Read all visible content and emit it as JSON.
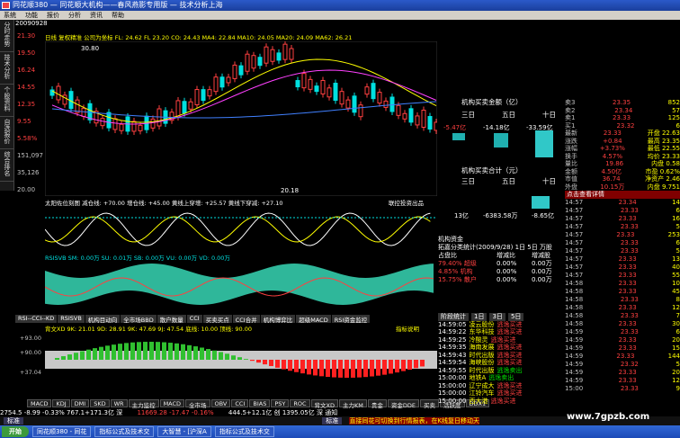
{
  "window": {
    "title": "同花顺380 — 同花顺大机构——春风燕影专用版 — 技术分析上海"
  },
  "menu": [
    "系统",
    "功能",
    "报价",
    "分析",
    "资讯",
    "帮助"
  ],
  "toolbar": [
    "同花顺",
    "趋势先锋",
    "自选股",
    "资金动向",
    "LEVEL-2",
    "大机构客服",
    "技术分析",
    "分析",
    "板块指数",
    "港汇",
    "发现"
  ],
  "sidetabs": [
    "分时走势",
    "技术分析",
    "个股资料",
    "自选报价",
    "综合排名"
  ],
  "chart": {
    "date": "20090928",
    "info": "日线 复权精准 公司为坐标 FL: 24.62 FL 23.20 CO: 24.43 MA4: 22.84 MA10: 24.05 MA20: 24.09 MA62: 26.21",
    "yticks": [
      "21.30",
      "19.50",
      "16.24",
      "14.55",
      "12.35",
      "9.55",
      "5.58%",
      "151,097",
      "35,126",
      "20.00"
    ],
    "hi_label": "30.80",
    "lo_label": "20.18"
  },
  "panels": {
    "sun": "太阳佐位刻图 减仓线: +70.00 增仓线: +45.00 黄线上穿增: +25.57 黄线下穿减: +27.10",
    "sun_right": "联控投资出品",
    "rsi": "RSISVB SM: 0.00万 SU: 0.01万 SB: 0.00万 VU: 0.00万 VD: 0.00万",
    "kdj": "背文XD 9K: 21.01 9D: 28.91 9K: 47.69 9J: 47.54 底线: 10.00 顶线: 90.00",
    "kdj_right": "指标说明",
    "kdj_ticks": [
      "+93.00",
      "+90.00",
      "+37.04"
    ],
    "tabs": [
      "RSI--CCI--KD",
      "RSISVB",
      "机构目动向",
      "全市场BBD",
      "散户数量",
      "CCI",
      "买卖买点",
      "CCI合并",
      "机构博弈比",
      "超级MACD",
      "RSI资金监控"
    ]
  },
  "bottomtabs": [
    "MACD",
    "KDJ",
    "DMI",
    "SKD",
    "WR",
    "主力监控",
    "MACD",
    "全市场",
    "OBV",
    "CCI",
    "BIAS",
    "PSY",
    "ROC",
    "背文XD",
    "主力KM",
    "贵金",
    "资金DDE",
    "买卖",
    "活跃度",
    "DDX1"
  ],
  "status": {
    "left": "2754.5 -8.99 -0.33% 767.1+171.3亿 深",
    "mid": "11669.28 -17.47 -0.16%",
    "right": "444.5+12.1亿 创 1395.05亿 深 通知",
    "ticker": "直接同花可切换到行情报表，在K线复日移动天"
  },
  "statusbar2": {
    "a": "标准",
    "b": "标准"
  },
  "right": {
    "t1": "机构买卖金额（亿）",
    "cols": [
      "三日",
      "五日",
      "十日"
    ],
    "vals1": [
      "-5.47亿",
      "-14.18亿",
      "-33.59亿"
    ],
    "t2": "机构买卖合计（元）",
    "v2a": "-6383.58万",
    "v2b": "-8.65亿",
    "v2c": "13亿"
  },
  "funds": {
    "title": "机构资金",
    "sub": "拓嘉分类统计(2009/9/28) 1日 5日 万股",
    "rows": [
      [
        "占盘比",
        "增减比",
        "增减股"
      ],
      [
        "79.40% 超级",
        "0.00%",
        "0.00万"
      ],
      [
        "4.85% 机构",
        "0.00%",
        "0.00万"
      ],
      [
        "15.75% 散户",
        "0.00%",
        "0.00万"
      ]
    ]
  },
  "sectors": {
    "header": [
      "阶段统计",
      "1日",
      "3日",
      "5日"
    ],
    "rows": [
      [
        "14:59:05",
        "凌云股份",
        "逃逸买进"
      ],
      [
        "14:59:22",
        "东华科技",
        "逃逸买进"
      ],
      [
        "14:59:25",
        "冷酸灵",
        "逃逸买进"
      ],
      [
        "14:59:35",
        "海南发展",
        "逃逸买进"
      ],
      [
        "14:59:43",
        "时代出版",
        "逃逸买进"
      ],
      [
        "14:59:54",
        "海峡股份",
        "逃逸买进"
      ],
      [
        "14:59:55",
        "时代出版",
        "逃逸卖出"
      ],
      [
        "15:00:00",
        "地铁A",
        "逃逸卖出"
      ],
      [
        "15:00:00",
        "辽宁成大",
        "逃逸买进"
      ],
      [
        "15:00:00",
        "江铃汽车",
        "逃逸买进"
      ],
      [
        "15:00:00",
        "西大港",
        "逃逸买进"
      ]
    ]
  },
  "quote": {
    "rows": [
      [
        "卖3",
        "23.35",
        "852"
      ],
      [
        "卖2",
        "23.34",
        "57"
      ],
      [
        "卖1",
        "23.33",
        "125"
      ],
      [
        "买1",
        "23.32",
        "6"
      ],
      [
        "最新",
        "23.33",
        "开盘 22.63"
      ],
      [
        "涨跌",
        "+0.84",
        "最高 23.35"
      ],
      [
        "涨幅",
        "+3.73%",
        "最低 22.55"
      ],
      [
        "换手",
        "4.57%",
        "均价 23.33"
      ],
      [
        "量比",
        "19.86",
        "内盘 0.58"
      ],
      [
        "金额",
        "4.50亿",
        "市盈 0.62%"
      ],
      [
        "市值",
        "36.74",
        "净资产 2.46"
      ],
      [
        "外盘",
        "10.15万",
        "内盘 9.751"
      ]
    ]
  },
  "ticks": {
    "title": "点击查看详情",
    "rows": [
      [
        "14:57",
        "23.34",
        "14"
      ],
      [
        "14:57",
        "23.33",
        "6"
      ],
      [
        "14:57",
        "23.33",
        "16"
      ],
      [
        "14:57",
        "23.33",
        "5"
      ],
      [
        "14:57",
        "23.33",
        "253"
      ],
      [
        "14:57",
        "23.33",
        "6"
      ],
      [
        "14:57",
        "23.33",
        "5"
      ],
      [
        "14:57",
        "23.33",
        "13"
      ],
      [
        "14:57",
        "23.33",
        "40"
      ],
      [
        "14:57",
        "23.33",
        "55"
      ],
      [
        "14:58",
        "23.33",
        "10"
      ],
      [
        "14:58",
        "23.33",
        "45"
      ],
      [
        "14:58",
        "23.33",
        "8"
      ],
      [
        "14:58",
        "23.33",
        "12"
      ],
      [
        "14:58",
        "23.33",
        "7"
      ],
      [
        "14:58",
        "23.33",
        "30"
      ],
      [
        "14:59",
        "23.33",
        "6"
      ],
      [
        "14:59",
        "23.33",
        "20"
      ],
      [
        "14:59",
        "23.33",
        "15"
      ],
      [
        "14:59",
        "23.33",
        "144"
      ],
      [
        "14:59",
        "23.32",
        "5"
      ],
      [
        "14:59",
        "23.33",
        "20"
      ],
      [
        "14:59",
        "23.33",
        "12"
      ],
      [
        "15:00",
        "23.33",
        "9"
      ]
    ]
  },
  "taskbar": {
    "start": "开始",
    "tasks": [
      "同花顺380 - 同花",
      "指标公式及技术交",
      "大智慧 - [沪深A",
      "指标公式及技术交"
    ],
    "watermark": "www.7gpzb.com"
  }
}
